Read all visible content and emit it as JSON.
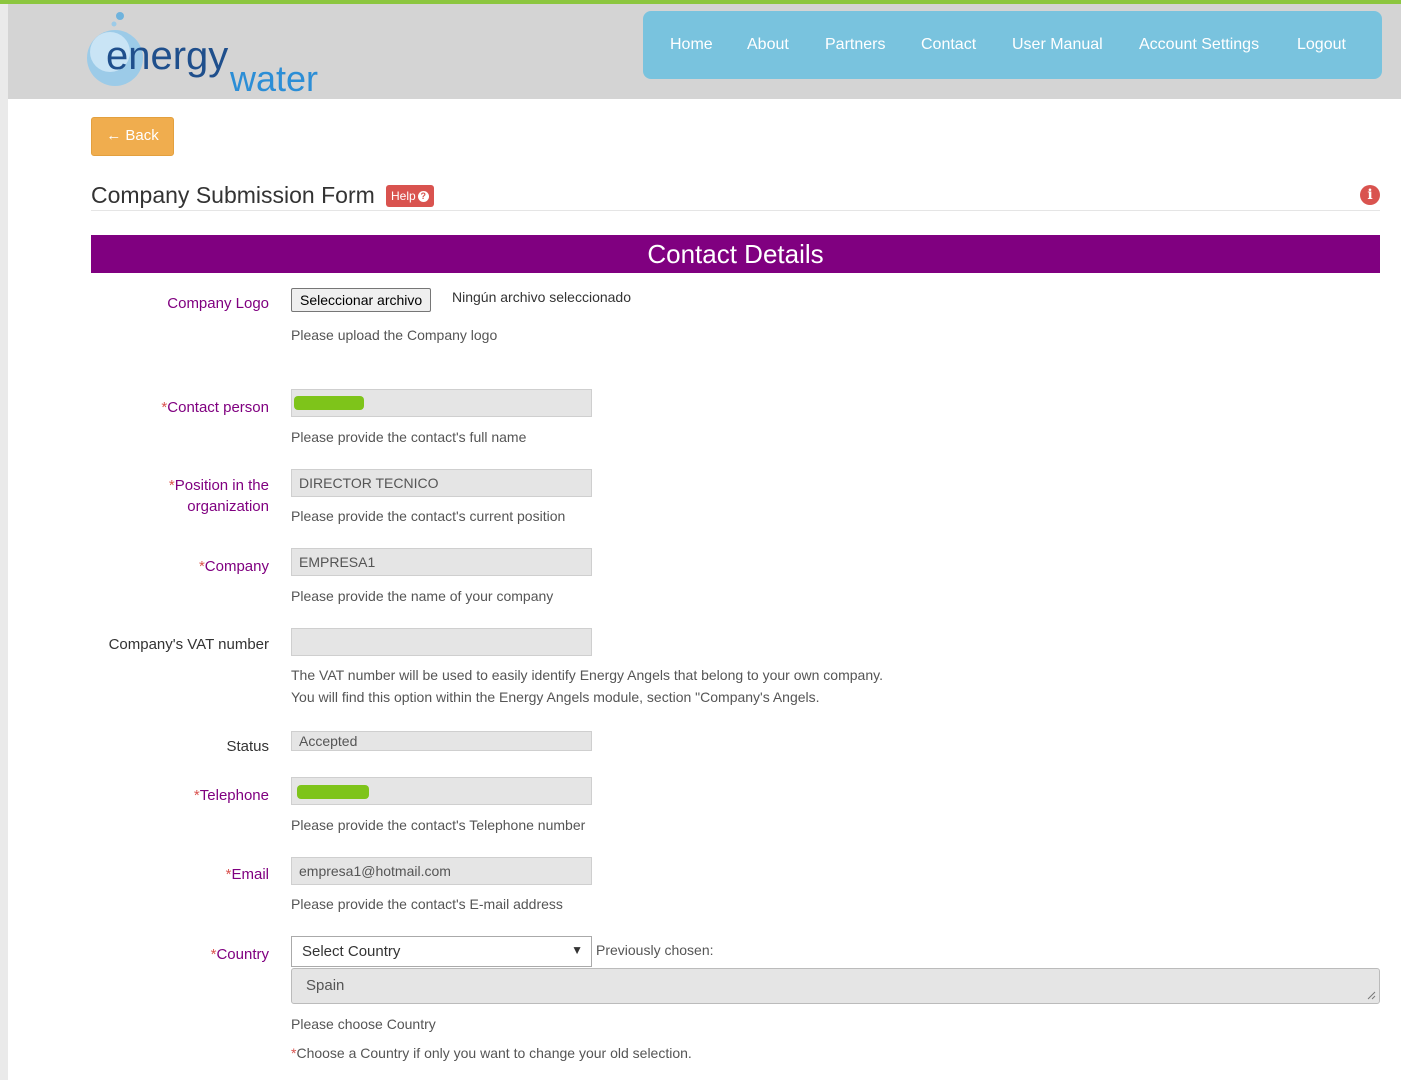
{
  "header": {
    "logo": {
      "word1": "energy",
      "word2": "water"
    },
    "nav": [
      "Home",
      "About",
      "Partners",
      "Contact",
      "User Manual",
      "Account Settings",
      "Logout"
    ]
  },
  "back_button": "← Back",
  "page": {
    "title": "Company Submission Form",
    "help_label": "Help",
    "info_icon": "info-circle-icon"
  },
  "section": {
    "title": "Contact Details"
  },
  "form": {
    "company_logo": {
      "label": "Company Logo",
      "file_button": "Seleccionar archivo",
      "file_status": "Ningún archivo seleccionado",
      "hint": "Please upload the Company logo"
    },
    "contact_person": {
      "required_mark": "*",
      "label": "Contact person",
      "value": "",
      "hint": "Please provide the contact's full name"
    },
    "position": {
      "required_mark": "*",
      "label_line1": "Position in the",
      "label_line2": "organization",
      "value": "DIRECTOR TECNICO",
      "hint": "Please provide the contact's current position"
    },
    "company": {
      "required_mark": "*",
      "label": "Company",
      "value": "EMPRESA1",
      "hint": "Please provide the name of your company"
    },
    "vat": {
      "label": "Company's VAT number",
      "value": "",
      "hint_line1": "The VAT number will be used to easily identify Energy Angels that belong to your own company.",
      "hint_line2": "You will find this option within the Energy Angels module, section \"Company's Angels."
    },
    "status": {
      "label": "Status",
      "value": "Accepted"
    },
    "telephone": {
      "required_mark": "*",
      "label": "Telephone",
      "value": "",
      "hint": "Please provide the contact's Telephone number"
    },
    "email": {
      "required_mark": "*",
      "label": "Email",
      "value": "empresa1@hotmail.com",
      "hint": "Please provide the contact's E-mail address"
    },
    "country": {
      "required_mark": "*",
      "label": "Country",
      "select_value": "Select Country",
      "previously_chosen_label": "Previously chosen:",
      "previous_value": "Spain",
      "hint": "Please choose Country",
      "note_mark": "*",
      "note": "Choose a Country if only you want to change your old selection."
    }
  },
  "colors": {
    "accent_purple": "#800080",
    "nav_bg": "#79c3de",
    "back_button": "#f0ad4e",
    "help_red": "#d9534f",
    "top_strip": "#8cc63f"
  }
}
